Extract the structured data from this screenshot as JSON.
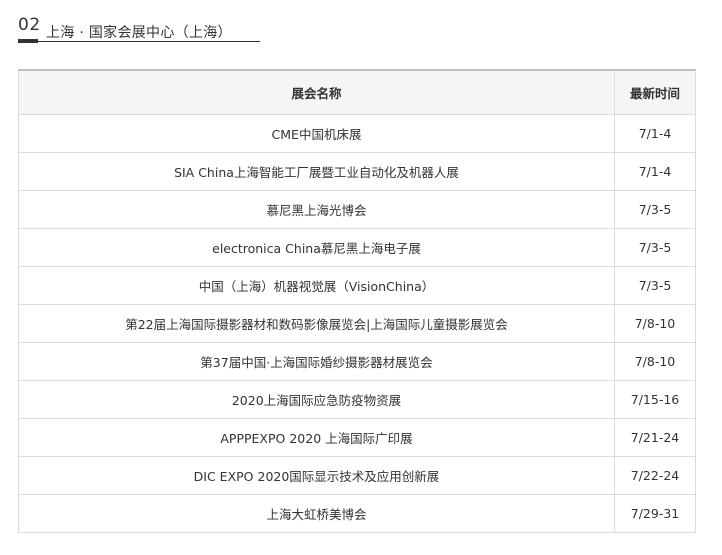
{
  "section": {
    "number": "02",
    "title": "上海 · 国家会展中心（上海）"
  },
  "table": {
    "headers": {
      "name": "展会名称",
      "date": "最新时间"
    },
    "rows": [
      {
        "name": "CME中国机床展",
        "date": "7/1-4"
      },
      {
        "name": "SIA China上海智能工厂展暨工业自动化及机器人展",
        "date": "7/1-4"
      },
      {
        "name": "慕尼黑上海光博会",
        "date": "7/3-5"
      },
      {
        "name": "electronica China慕尼黑上海电子展",
        "date": "7/3-5"
      },
      {
        "name": "中国（上海）机器视觉展（VisionChina）",
        "date": "7/3-5"
      },
      {
        "name": "第22届上海国际摄影器材和数码影像展览会|上海国际儿童摄影展览会",
        "date": "7/8-10"
      },
      {
        "name": "第37届中国·上海国际婚纱摄影器材展览会",
        "date": "7/8-10"
      },
      {
        "name": "2020上海国际应急防疫物资展",
        "date": "7/15-16"
      },
      {
        "name": "APPPEXPO 2020 上海国际广印展",
        "date": "7/21-24"
      },
      {
        "name": "DIC EXPO 2020国际显示技术及应用创新展",
        "date": "7/22-24"
      },
      {
        "name": "上海大虹桥美博会",
        "date": "7/29-31"
      }
    ]
  }
}
